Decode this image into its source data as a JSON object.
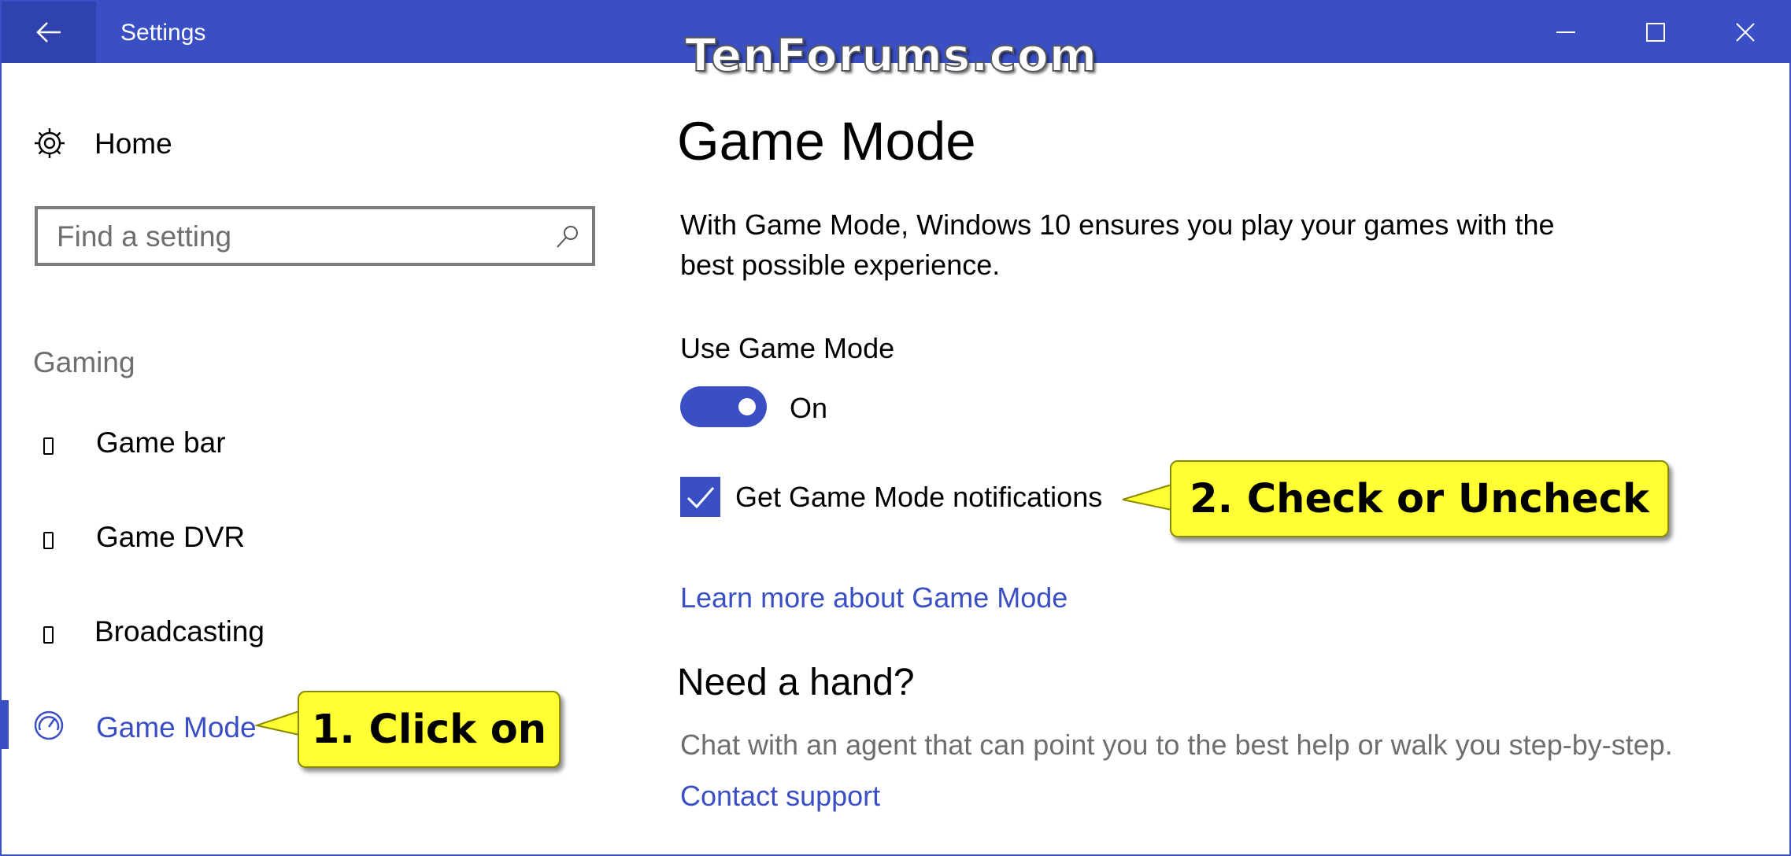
{
  "window": {
    "title": "Settings",
    "watermark": "TenForums.com"
  },
  "sidebar": {
    "home_label": "Home",
    "search_placeholder": "Find a setting",
    "section_label": "Gaming",
    "items": [
      {
        "label": "Game bar",
        "icon": "tile-glyph-icon"
      },
      {
        "label": "Game DVR",
        "icon": "tile-glyph-icon"
      },
      {
        "label": "Broadcasting",
        "icon": "tile-glyph-icon"
      },
      {
        "label": "Game Mode",
        "icon": "gauge-icon",
        "selected": true
      }
    ]
  },
  "main": {
    "title": "Game Mode",
    "description": "With Game Mode, Windows 10 ensures you play your games with the best possible experience.",
    "toggle_label": "Use Game Mode",
    "toggle_state": "On",
    "toggle_on": true,
    "checkbox_label": "Get Game Mode notifications",
    "checkbox_checked": true,
    "learn_more": "Learn more about Game Mode",
    "help_heading": "Need a hand?",
    "help_text": "Chat with an agent that can point you to the best help or walk you step-by-step.",
    "contact_link": "Contact support"
  },
  "callouts": {
    "first": "1. Click on",
    "second": "2. Check or Uncheck"
  },
  "colors": {
    "accent": "#3b4fc4",
    "callout_fill": "#ffff33",
    "secondary_text": "#6e6e6e"
  }
}
